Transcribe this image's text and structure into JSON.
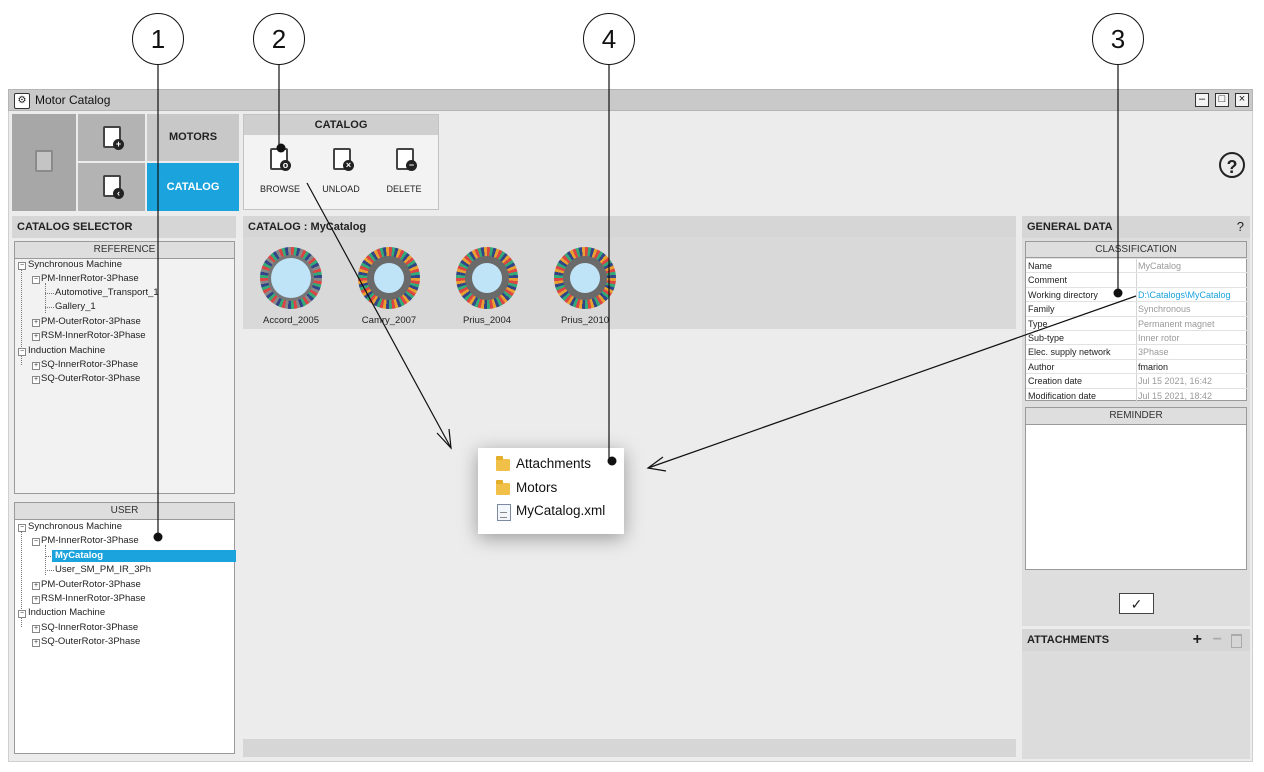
{
  "callouts": [
    "1",
    "2",
    "4",
    "3"
  ],
  "window": {
    "title": "Motor Catalog",
    "minimize": "–",
    "maximize": "□",
    "close": "×"
  },
  "tabs": {
    "motors": "MOTORS",
    "catalog": "CATALOG"
  },
  "catalog_toolbar": {
    "header": "CATALOG",
    "browse": "BROWSE",
    "unload": "UNLOAD",
    "delete": "DELETE"
  },
  "help_symbol": "?",
  "selector": {
    "title": "CATALOG SELECTOR",
    "reference_header": "REFERENCE",
    "reference_tree": [
      {
        "label": "Synchronous Machine"
      },
      {
        "label": "PM-InnerRotor-3Phase"
      },
      {
        "label": "Automotive_Transport_1"
      },
      {
        "label": "Gallery_1"
      },
      {
        "label": "PM-OuterRotor-3Phase"
      },
      {
        "label": "RSM-InnerRotor-3Phase"
      },
      {
        "label": "Induction Machine"
      },
      {
        "label": "SQ-InnerRotor-3Phase"
      },
      {
        "label": "SQ-OuterRotor-3Phase"
      }
    ],
    "user_header": "USER",
    "user_tree": [
      {
        "label": "Synchronous Machine"
      },
      {
        "label": "PM-InnerRotor-3Phase"
      },
      {
        "label": "MyCatalog"
      },
      {
        "label": "User_SM_PM_IR_3Ph"
      },
      {
        "label": "PM-OuterRotor-3Phase"
      },
      {
        "label": "RSM-InnerRotor-3Phase"
      },
      {
        "label": "Induction Machine"
      },
      {
        "label": "SQ-InnerRotor-3Phase"
      },
      {
        "label": "SQ-OuterRotor-3Phase"
      }
    ]
  },
  "catalog_view": {
    "title": "CATALOG : MyCatalog",
    "motors": [
      {
        "name": "Accord_2005"
      },
      {
        "name": "Camry_2007"
      },
      {
        "name": "Prius_2004"
      },
      {
        "name": "Prius_2010"
      }
    ]
  },
  "general_data": {
    "title": "GENERAL DATA",
    "help": "?",
    "classification_header": "CLASSIFICATION",
    "rows": [
      {
        "key": "Name",
        "value": "MyCatalog"
      },
      {
        "key": "Comment",
        "value": ""
      },
      {
        "key": "Working directory",
        "value": "D:\\Catalogs\\MyCatalog"
      },
      {
        "key": "Family",
        "value": "Synchronous"
      },
      {
        "key": "Type",
        "value": "Permanent magnet"
      },
      {
        "key": "Sub-type",
        "value": "Inner rotor"
      },
      {
        "key": "Elec. supply network",
        "value": "3Phase"
      },
      {
        "key": "Author",
        "value": "fmarion"
      },
      {
        "key": "Creation date",
        "value": "Jul 15 2021, 16:42"
      },
      {
        "key": "Modification date",
        "value": "Jul 15 2021, 18:42"
      }
    ],
    "reminder_header": "REMINDER",
    "check_symbol": "✓",
    "attachments": {
      "title": "ATTACHMENTS",
      "add": "+",
      "remove": "−"
    }
  },
  "popup": {
    "items": [
      {
        "label": "Attachments",
        "icon": "folder-icon"
      },
      {
        "label": "Motors",
        "icon": "folder-icon"
      },
      {
        "label": "MyCatalog.xml",
        "icon": "xml-file-icon"
      }
    ]
  },
  "colors": {
    "accent": "#1aa3dc",
    "panel": "#ececec",
    "header": "#d6d6d6"
  }
}
